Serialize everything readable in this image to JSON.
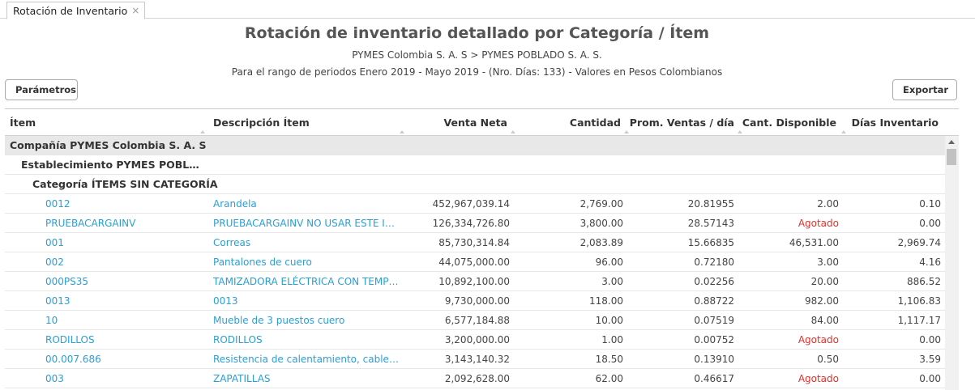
{
  "tab": {
    "label": "Rotación de Inventario",
    "close": "×"
  },
  "header": {
    "title": "Rotación de inventario detallado por Categoría / Ítem",
    "breadcrumb": "PYMES Colombia S. A. S > PYMES POBLADO S. A. S.",
    "range": "Para el rango de periodos Enero 2019 - Mayo 2019 - (Nro. Días: 133) - Valores en Pesos Colombianos"
  },
  "toolbar": {
    "params_label": "Parámetros",
    "export_label": "Exportar"
  },
  "columns": [
    "Ítem",
    "Descripción Ítem",
    "Venta Neta",
    "Cantidad",
    "Prom. Ventas / día",
    "Cant. Disponible",
    "Días Inventario"
  ],
  "groups": {
    "company": "Compañía PYMES Colombia S. A. S",
    "establishment": "Establecimiento PYMES POBLADO S. A. S.",
    "category": "Categoría ÍTEMS SIN CATEGORÍA"
  },
  "rows": [
    {
      "item": "0012",
      "desc": "Arandela",
      "venta": "452,967,039.14",
      "cant": "2,769.00",
      "prom": "20.81955",
      "disp": "2.00",
      "dias": "0.10"
    },
    {
      "item": "PRUEBACARGAINV",
      "desc": "PRUEBACARGAINV NO USAR ESTE ITEM",
      "venta": "126,334,726.80",
      "cant": "3,800.00",
      "prom": "28.57143",
      "disp": "Agotado",
      "dias": "0.00"
    },
    {
      "item": "001",
      "desc": "Correas",
      "venta": "85,730,314.84",
      "cant": "2,083.89",
      "prom": "15.66835",
      "disp": "46,531.00",
      "dias": "2,969.74"
    },
    {
      "item": "002",
      "desc": "Pantalones de cuero",
      "venta": "44,075,000.00",
      "cant": "96.00",
      "prom": "0.72180",
      "disp": "3.00",
      "dias": "4.16"
    },
    {
      "item": "000PS35",
      "desc": "TAMIZADORA ELÉCTRICA CON TEMPORIZADOR",
      "venta": "10,892,100.00",
      "cant": "3.00",
      "prom": "0.02256",
      "disp": "20.00",
      "dias": "886.52"
    },
    {
      "item": "0013",
      "desc": "0013",
      "venta": "9,730,000.00",
      "cant": "118.00",
      "prom": "0.88722",
      "disp": "982.00",
      "dias": "1,106.83"
    },
    {
      "item": "10",
      "desc": "Mueble de 3 puestos cuero",
      "venta": "6,577,184.88",
      "cant": "10.00",
      "prom": "0.07519",
      "disp": "84.00",
      "dias": "1,117.17"
    },
    {
      "item": "RODILLOS",
      "desc": "RODILLOS",
      "venta": "3,200,000.00",
      "cant": "1.00",
      "prom": "0.00752",
      "disp": "Agotado",
      "dias": "0.00"
    },
    {
      "item": "00.007.686",
      "desc": "Resistencia de calentamiento, cableado, ensamblada",
      "venta": "3,143,140.32",
      "cant": "18.50",
      "prom": "0.13910",
      "disp": "0.50",
      "dias": "3.59"
    },
    {
      "item": "003",
      "desc": "ZAPATILLAS",
      "venta": "2,092,628.00",
      "cant": "62.00",
      "prom": "0.46617",
      "disp": "Agotado",
      "dias": "0.00"
    }
  ],
  "colors": {
    "link": "#2a9fd6",
    "exhausted": "#e0302a",
    "group_bg": "#e8e8e8"
  }
}
